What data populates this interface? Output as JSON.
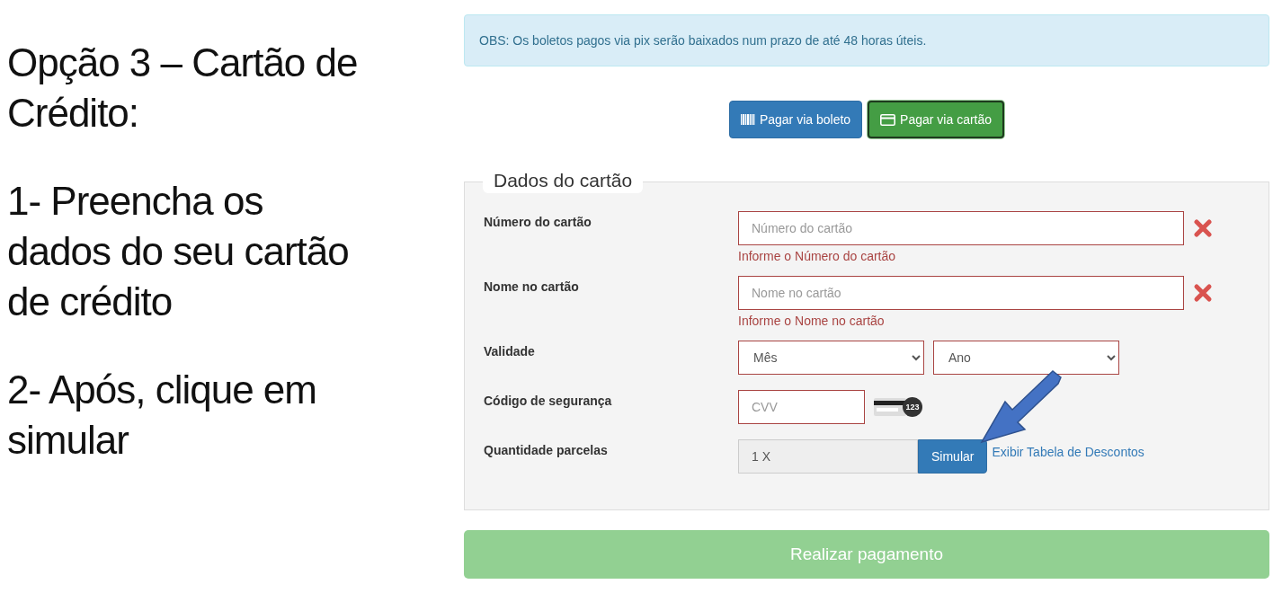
{
  "instructions": {
    "title": "Opção 3 – Cartão de Crédito:",
    "steps": [
      "1- Preencha os dados do seu cartão de crédito",
      "2- Após, clique em simular"
    ]
  },
  "notice": "OBS: Os boletos pagos via pix serão baixados num prazo de até 48 horas úteis.",
  "payment_methods": [
    {
      "label": "Pagar via boleto",
      "kind": "barcode",
      "selected": false
    },
    {
      "label": "Pagar via cartão",
      "kind": "card",
      "selected": true
    }
  ],
  "card_form": {
    "legend": "Dados do cartão",
    "fields": [
      {
        "kind": "text",
        "label": "Número do cartão",
        "placeholder": "Número do cartão",
        "error": "Informe o Número do cartão",
        "invalid": true
      },
      {
        "kind": "text",
        "label": "Nome no cartão",
        "placeholder": "Nome no cartão",
        "error": "Informe o Nome no cartão",
        "invalid": true
      },
      {
        "kind": "selects",
        "label": "Validade",
        "invalid": true,
        "selects": [
          {
            "placeholder": "Mês"
          },
          {
            "placeholder": "Ano"
          }
        ]
      },
      {
        "kind": "cvv",
        "label": "Código de segurança",
        "placeholder": "CVV",
        "badge": "123",
        "invalid": true
      },
      {
        "kind": "installments",
        "label": "Quantidade parcelas",
        "value": "1 X",
        "button": "Simular",
        "link": "Exibir Tabela de Descontos"
      }
    ]
  },
  "submit": {
    "label": "Realizar pagamento",
    "disabled": true
  }
}
